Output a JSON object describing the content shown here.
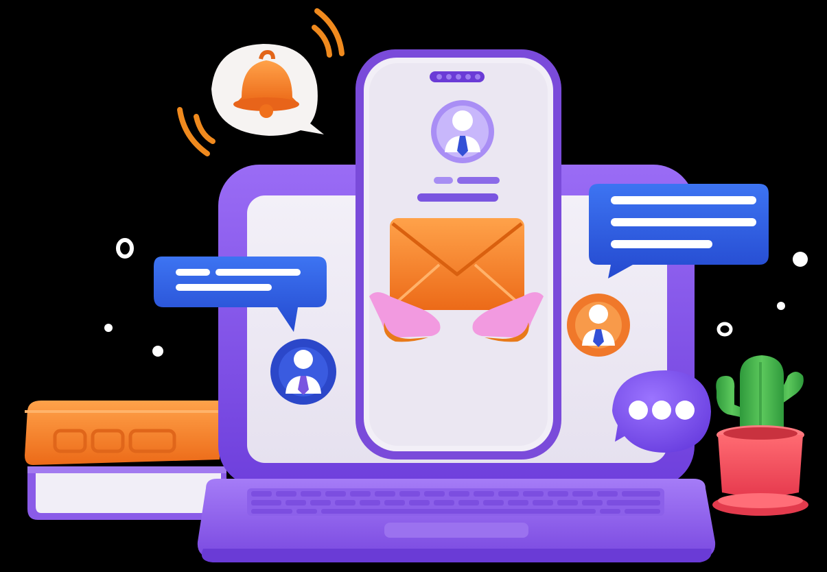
{
  "colors": {
    "background": "#000000",
    "laptop_frame": "#8b5cf6",
    "laptop_frame_dark": "#6d3fe0",
    "screen": "#eeeaf5",
    "phone_frame": "#7c4ddb",
    "accent_orange": "#f58a2c",
    "bubble_blue": "#2f5fe6",
    "avatar_blue": "#2b47c9",
    "avatar_orange": "#f0782a",
    "cactus_green": "#3fae4a",
    "pot_pink": "#f04a5c",
    "book_orange": "#f5882c",
    "book_purple": "#8a5be8"
  },
  "icons": [
    "bell-icon",
    "envelope-icon",
    "chat-bubble-icon",
    "typing-bubble-icon",
    "user-avatar-icon",
    "cactus-icon",
    "books-icon",
    "laptop-icon",
    "smartphone-icon"
  ]
}
